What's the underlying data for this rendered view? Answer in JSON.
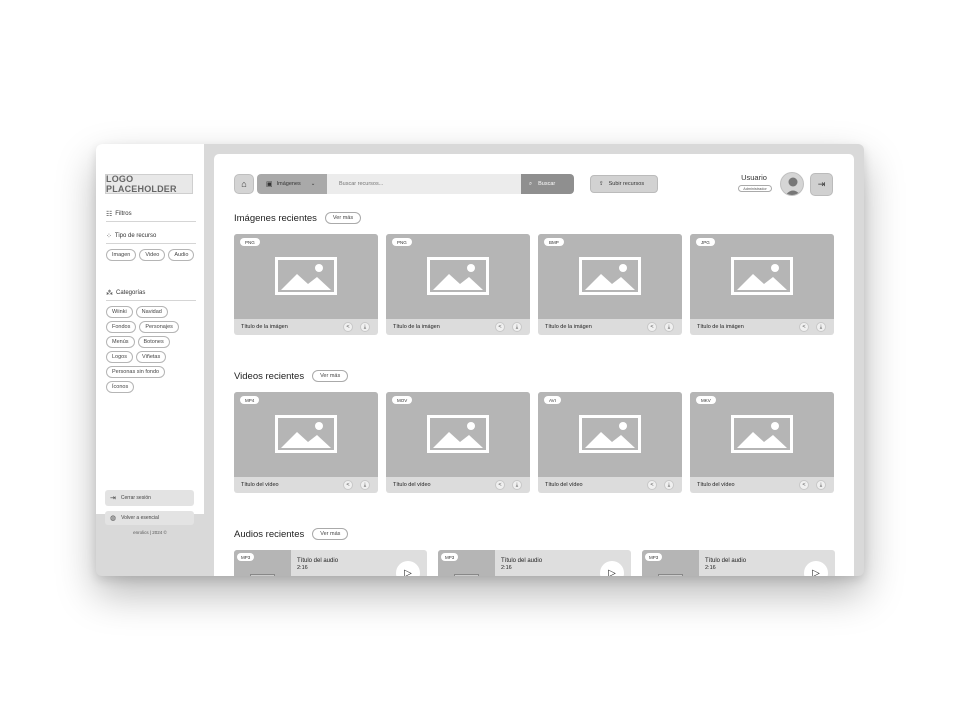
{
  "sidebar": {
    "logo": "LOGO PLACEHOLDER",
    "filters_label": "Filtros",
    "resource_type": {
      "label": "Tipo de recurso",
      "chips": [
        "Imagen",
        "Video",
        "Audio"
      ]
    },
    "categories": {
      "label": "Categorías",
      "chips": [
        "Wiinki",
        "Navidad",
        "Fondos",
        "Personajes",
        "Menús",
        "Botones",
        "Logos",
        "Viñetas",
        "Personas sin fondo",
        "Íconos"
      ]
    },
    "logout_label": "Cerrar sesión",
    "back_label": "Volver a esencial",
    "copyright": "enrolics | 2024 ©"
  },
  "topbar": {
    "type_select": "Imágenes",
    "search_placeholder": "Buscar recursos...",
    "search_button": "Buscar",
    "upload_button": "Subir recursos",
    "user_name": "Usuario",
    "user_role": "Administrador"
  },
  "images": {
    "title": "Imágenes recientes",
    "see_more": "Ver más",
    "items": [
      {
        "format": "PNG",
        "title": "Título de la imágen"
      },
      {
        "format": "PNG",
        "title": "Título de la imágen"
      },
      {
        "format": "BMP",
        "title": "Título de la imágen"
      },
      {
        "format": "JPG",
        "title": "Título de la imágen"
      }
    ]
  },
  "videos": {
    "title": "Videos recientes",
    "see_more": "Ver más",
    "items": [
      {
        "format": "MP4",
        "title": "Título del vídeo"
      },
      {
        "format": "MOV",
        "title": "Título del vídeo"
      },
      {
        "format": "AVI",
        "title": "Título del vídeo"
      },
      {
        "format": "MKV",
        "title": "Título del vídeo"
      }
    ]
  },
  "audios": {
    "title": "Audios recientes",
    "see_more": "Ver más",
    "items": [
      {
        "format": "MP3",
        "title": "Título del audio",
        "duration": "2:16"
      },
      {
        "format": "MP3",
        "title": "Título del audio",
        "duration": "2:16"
      },
      {
        "format": "MP3",
        "title": "Título del audio",
        "duration": "2:16"
      }
    ]
  },
  "icons": {
    "filters": "sliders-icon",
    "resource_type": "shapes-icon",
    "categories": "category-icon",
    "home": "home-icon",
    "image": "image-icon",
    "chevron": "chevron-down-icon",
    "search": "search-icon",
    "upload": "upload-icon",
    "logout": "logout-icon",
    "share": "share-icon",
    "download": "download-icon",
    "play": "play-icon"
  },
  "colors": {
    "window_bg": "#d9d9d9",
    "thumb": "#b5b5b5",
    "search_button": "#8f8f8f",
    "type_select": "#a9a9a9"
  }
}
